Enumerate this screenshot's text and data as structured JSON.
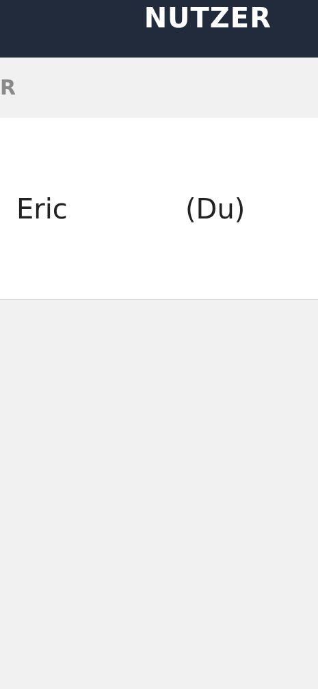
{
  "header": {
    "title": "NUTZER"
  },
  "section": {
    "label": "R"
  },
  "users": [
    {
      "name": "Eric",
      "note": "(Du)"
    }
  ]
}
